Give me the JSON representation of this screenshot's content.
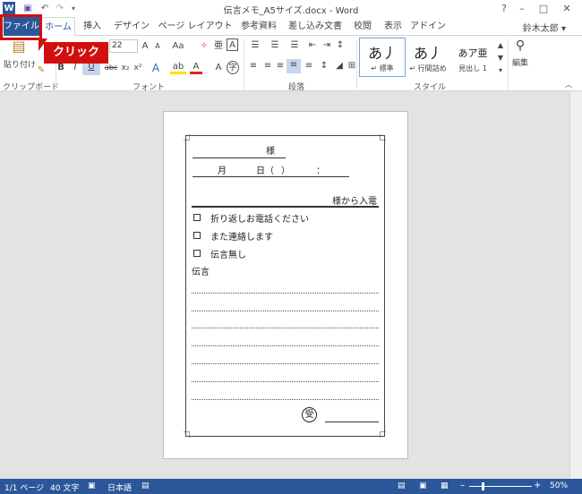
{
  "window": {
    "title": "伝言メモ_A5サイズ.docx - Word",
    "minimize": "–",
    "restore": "□",
    "close": "✕",
    "help": "?"
  },
  "qat": {
    "word_icon": "W",
    "save": "▣",
    "undo": "↶",
    "redo": "↷",
    "more": "▾"
  },
  "tabs": {
    "file": "ファイル",
    "home": "ホーム",
    "insert": "挿入",
    "design": "デザイン",
    "page_layout": "ページ レイアウト",
    "references": "参考資料",
    "mailings": "差し込み文書",
    "review": "校閲",
    "view": "表示",
    "addins": "アドイン"
  },
  "user": {
    "name": "鈴木太郎 ▾"
  },
  "callout": {
    "text": "クリック"
  },
  "ribbon": {
    "clipboard": {
      "paste_label": "貼り付け",
      "group": "クリップボード"
    },
    "font": {
      "size": "22",
      "bold": "B",
      "italic": "I",
      "underline": "U",
      "strike": "abc",
      "sub": "x₂",
      "sup": "x²",
      "group": "フォント"
    },
    "paragraph": {
      "group": "段落"
    },
    "styles": {
      "group": "スタイル",
      "items": [
        {
          "sample": "あ丿",
          "name": "↵ 標準"
        },
        {
          "sample": "あ丿",
          "name": "↵ 行間詰め"
        },
        {
          "sample": "あア亜",
          "name": "見出し 1"
        }
      ]
    },
    "editing": {
      "label": "編集"
    }
  },
  "memo": {
    "sama": "様",
    "month": "月",
    "day": "日（",
    "paren_close": "）",
    "colon": "：",
    "from": "様から入電",
    "checks": [
      "折り返しお電話ください",
      "また連絡します",
      "伝言無し"
    ],
    "message_label": "伝言",
    "received": "受"
  },
  "status": {
    "page": "1/1 ページ",
    "words": "40 文字",
    "language": "日本語",
    "zoom": "50%"
  }
}
